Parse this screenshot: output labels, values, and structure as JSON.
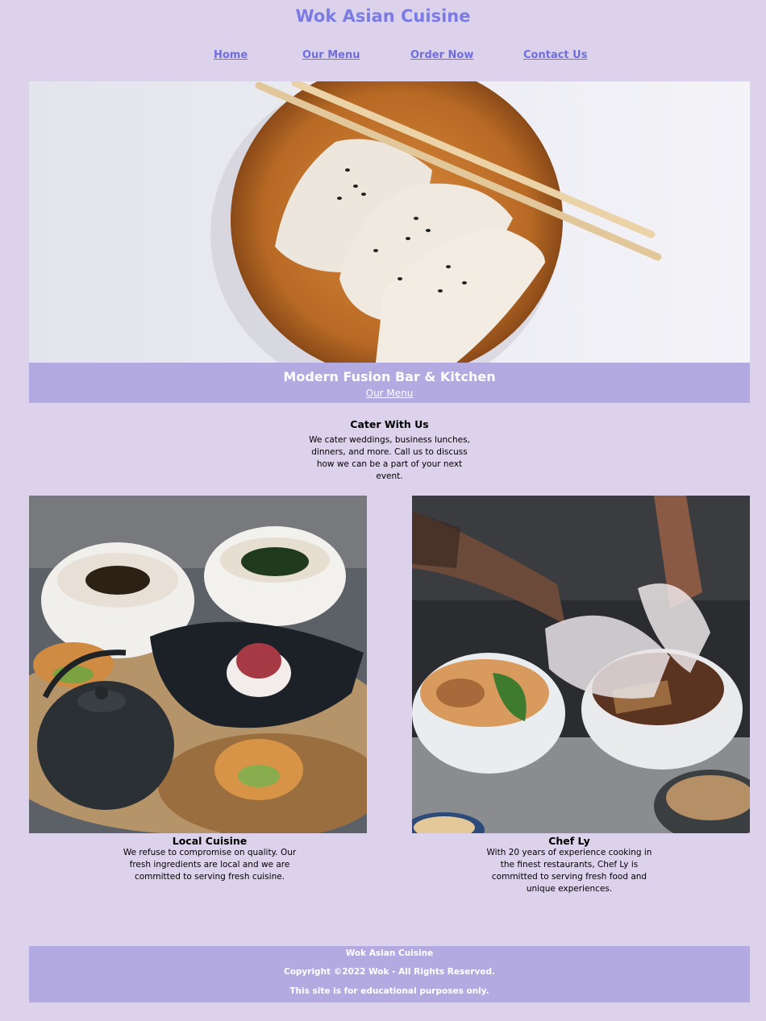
{
  "header": {
    "title": "Wok Asian Cuisine"
  },
  "nav": {
    "items": [
      {
        "label": "Home"
      },
      {
        "label": "Our Menu"
      },
      {
        "label": "Order Now"
      },
      {
        "label": "Contact Us"
      }
    ],
    "link_color": "#6e6ede"
  },
  "hero": {
    "heading": "Modern Fusion Bar & Kitchen",
    "link": "Our Menu",
    "band_color": "#b4aae2"
  },
  "cater": {
    "title": "Cater With Us",
    "text": "We cater weddings, business lunches, dinners, and more. Call us to discuss how we can be a part of your next event."
  },
  "cards": [
    {
      "title": "Local Cuisine",
      "text": "We refuse to compromise on quality. Our fresh ingredients are local and we are committed to serving fresh cuisine."
    },
    {
      "title": "Chef Ly",
      "text": "With 20 years of experience cooking in the finest restaurants, Chef Ly is committed to serving fresh food and unique experiences."
    }
  ],
  "footer": {
    "name": "Wok Asian Cuisine",
    "copyright": "Copyright ©2022 Wok - All Rights Reserved.",
    "note": "This site is for educational purposes only."
  },
  "colors": {
    "background": "#dcd2ec",
    "title": "#7a7ce4"
  }
}
